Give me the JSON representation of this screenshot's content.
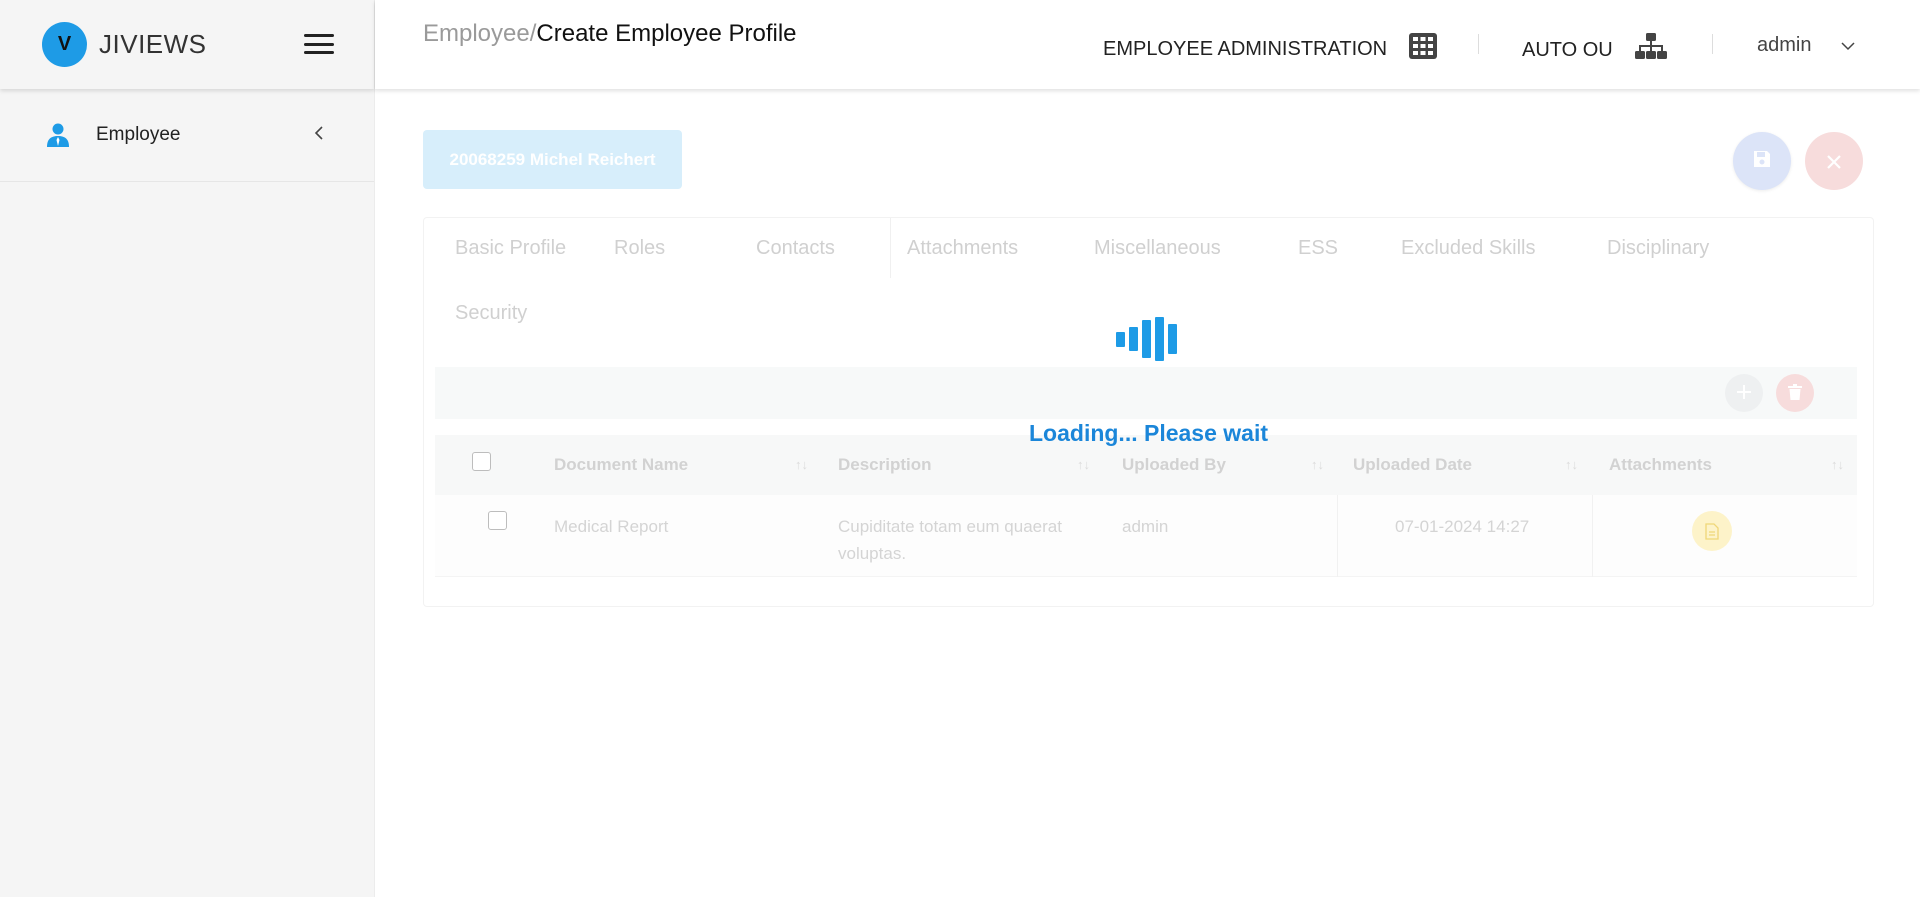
{
  "brand": {
    "logo_letter": "V",
    "name": "JIVIEWS"
  },
  "sidebar": {
    "items": [
      {
        "label": "Employee",
        "icon": "user-icon"
      }
    ]
  },
  "header": {
    "breadcrumb_parent": "Employee",
    "breadcrumb_sep": "/",
    "breadcrumb_current": "Create Employee Profile",
    "module": "EMPLOYEE ADMINISTRATION",
    "org_unit": "AUTO OU",
    "user": "admin"
  },
  "employee": {
    "chip_label": "20068259 Michel Reichert"
  },
  "tabs": [
    "Basic Profile",
    "Roles",
    "Contacts",
    "Attachments",
    "Miscellaneous",
    "ESS",
    "Excluded Skills",
    "Disciplinary",
    "Security"
  ],
  "table": {
    "columns": [
      "Document Name",
      "Description",
      "Uploaded By",
      "Uploaded Date",
      "Attachments"
    ],
    "rows": [
      {
        "document_name": "Medical Report",
        "description_line1": "Cupiditate totam eum quaerat",
        "description_line2": "voluptas.",
        "uploaded_by": "admin",
        "uploaded_date": "07-01-2024 14:27"
      }
    ]
  },
  "loading": {
    "text": "Loading... Please wait"
  },
  "colors": {
    "accent": "#1e9be6",
    "loading_text": "#1b86d9"
  }
}
